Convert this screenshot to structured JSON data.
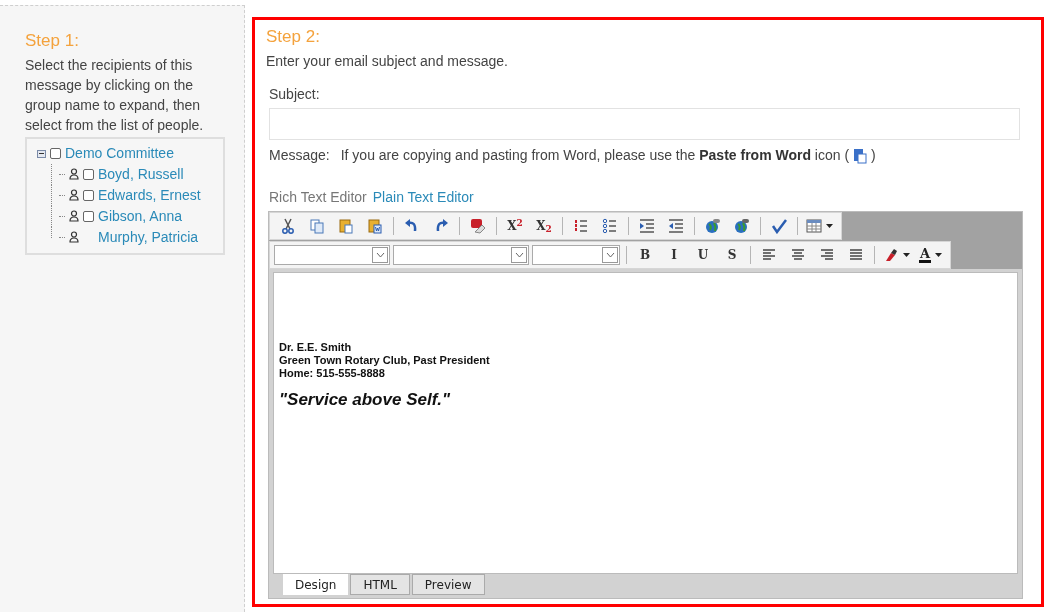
{
  "step1": {
    "title": "Step 1:",
    "instructions": "Select the recipients of this message by clicking on the group name to expand, then select from the list of people.",
    "tree": [
      {
        "label": "Demo Committee",
        "expanded": true,
        "checked": false,
        "children": [
          {
            "label": "Boyd, Russell",
            "selectable": true,
            "checked": false
          },
          {
            "label": "Edwards, Ernest",
            "selectable": true,
            "checked": false
          },
          {
            "label": "Gibson, Anna",
            "selectable": true,
            "checked": false
          },
          {
            "label": "Murphy, Patricia",
            "selectable": false
          }
        ]
      }
    ]
  },
  "step2": {
    "title": "Step 2:",
    "instructions": "Enter your email subject and message.",
    "subject_label": "Subject:",
    "message_label": "Message:",
    "message_hint": "If you are copying and pasting from Word, please use the **Paste from Word** icon (",
    "message_hint_end": ")",
    "editor_modes": [
      {
        "label": "Rich Text Editor",
        "selected": true
      },
      {
        "label": "Plain Text Editor",
        "selected": false
      }
    ],
    "toolbar_rows": [
      [
        {
          "kind": "icon"
        },
        {
          "kind": "icon"
        },
        {
          "kind": "icon"
        },
        {
          "kind": "icon"
        },
        {
          "kind": "separator"
        },
        {
          "kind": "icon"
        },
        {
          "kind": "icon"
        },
        {
          "kind": "separator"
        },
        {
          "kind": "icon"
        },
        {
          "kind": "separator"
        },
        {
          "kind": "text",
          "label": "X$^{2}$"
        },
        {
          "kind": "text",
          "label": "X$_{2}$"
        },
        {
          "kind": "separator"
        },
        {
          "kind": "icon"
        },
        {
          "kind": "icon"
        },
        {
          "kind": "separator"
        },
        {
          "kind": "icon"
        },
        {
          "kind": "icon"
        },
        {
          "kind": "separator"
        },
        {
          "kind": "icon"
        },
        {
          "kind": "icon"
        },
        {
          "kind": "separator"
        },
        {
          "kind": "icon"
        },
        {
          "kind": "separator"
        },
        {
          "kind": "dropdown-icon"
        }
      ],
      [
        {
          "kind": "select"
        },
        {
          "kind": "select"
        },
        {
          "kind": "select"
        },
        {
          "kind": "separator"
        },
        {
          "kind": "text",
          "label": "B"
        },
        {
          "kind": "text",
          "label": "I"
        },
        {
          "kind": "text",
          "label": "U"
        },
        {
          "kind": "text",
          "label": "S"
        },
        {
          "kind": "separator"
        },
        {
          "kind": "icon"
        },
        {
          "kind": "icon"
        },
        {
          "kind": "icon"
        },
        {
          "kind": "icon"
        },
        {
          "kind": "separator"
        },
        {
          "kind": "dropdown-icon"
        },
        {
          "kind": "dropdown-text",
          "label": "A"
        }
      ]
    ],
    "signature": [
      "Dr. E.E. Smith",
      "Green Town Rotary Club, Past President",
      "Home: 515-555-8888"
    ],
    "motto": "\"Service above Self.\"",
    "tabs": [
      {
        "label": "Design",
        "selected": true
      },
      {
        "label": "HTML",
        "selected": false
      },
      {
        "label": "Preview",
        "selected": false
      }
    ]
  }
}
